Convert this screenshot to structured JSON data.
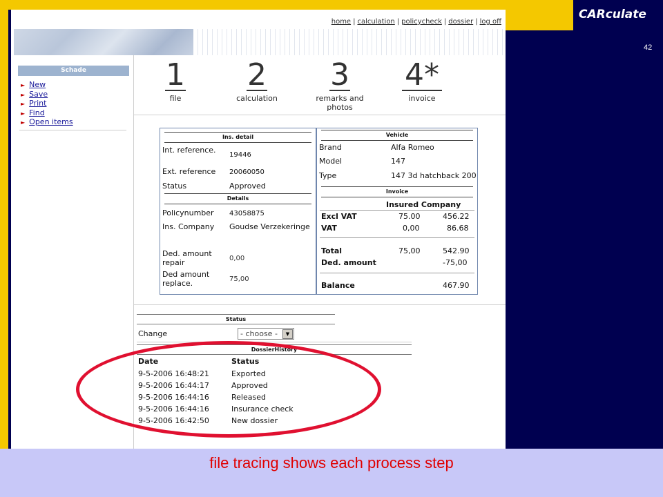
{
  "slide": {
    "logo": "CARculate",
    "number": "42",
    "caption": "file tracing shows each process step",
    "colors": {
      "frame": "#f4c800",
      "navy": "#000050",
      "caption_band": "#c8c8f8",
      "caption_text": "#e00000",
      "highlight": "#e01030"
    }
  },
  "nav": {
    "items": [
      "home",
      "calculation",
      "policycheck",
      "dossier",
      "log off"
    ]
  },
  "sidebar": {
    "title": "Schade",
    "items": [
      "New",
      "Save",
      "Print",
      "Find",
      "Open items"
    ]
  },
  "steps": [
    {
      "num": "1",
      "label": "file"
    },
    {
      "num": "2",
      "label": "calculation"
    },
    {
      "num": "3",
      "label": "remarks and photos"
    },
    {
      "num": "4*",
      "label": "invoice"
    }
  ],
  "ins_detail": {
    "title": "Ins. detail",
    "int_ref_label": "Int. reference.",
    "int_ref": "19446",
    "ext_ref_label": "Ext. reference",
    "ext_ref": "20060050",
    "status_label": "Status",
    "status": "Approved"
  },
  "details": {
    "title": "Details",
    "policy_label": "Policynumber",
    "policy": "43058875",
    "company_label": "Ins. Company",
    "company": "Goudse Verzekeringe",
    "ded_repair_label": "Ded. amount repair",
    "ded_repair": "0,00",
    "ded_replace_label": "Ded amount replace.",
    "ded_replace": "75,00"
  },
  "vehicle": {
    "title": "Vehicle",
    "brand_label": "Brand",
    "brand": "Alfa Romeo",
    "model_label": "Model",
    "model": "147",
    "type_label": "Type",
    "type": "147 3d hatchback 200"
  },
  "invoice": {
    "title": "Invoice",
    "header": "Insured Company",
    "rows": [
      {
        "label": "Excl VAT",
        "insured": "75.00",
        "company": "456.22"
      },
      {
        "label": "VAT",
        "insured": "0,00",
        "company": "86.68"
      },
      {
        "label": "Total",
        "insured": "75,00",
        "company": "542.90"
      },
      {
        "label": "Ded. amount",
        "insured": "",
        "company": "-75,00"
      }
    ],
    "balance_label": "Balance",
    "balance": "467.90"
  },
  "status_box": {
    "title": "Status",
    "change_label": "Change",
    "select_value": "- choose -"
  },
  "history": {
    "title": "DossierHistory",
    "col_date": "Date",
    "col_status": "Status",
    "rows": [
      {
        "date": "9-5-2006 16:48:21",
        "status": "Exported"
      },
      {
        "date": "9-5-2006 16:44:17",
        "status": "Approved"
      },
      {
        "date": "9-5-2006 16:44:16",
        "status": "Released"
      },
      {
        "date": "9-5-2006 16:44:16",
        "status": "Insurance check"
      },
      {
        "date": "9-5-2006 16:42:50",
        "status": "New dossier"
      }
    ]
  }
}
